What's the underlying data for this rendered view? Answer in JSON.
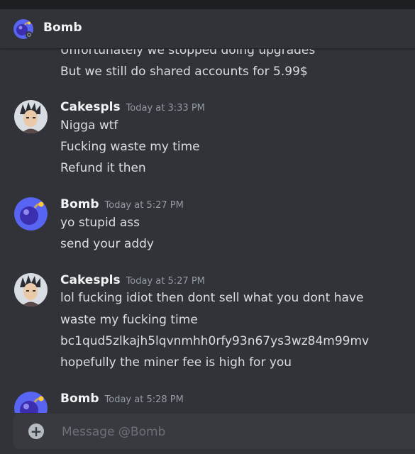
{
  "header": {
    "title": "Bomb"
  },
  "messages": [
    {
      "type": "continuation",
      "lines": [
        "Unfortunately we stopped doing upgrades",
        "But we still do shared accounts for 5.99$"
      ]
    },
    {
      "author": "Cakespls",
      "time": "Today at 3:33 PM",
      "avatar": "anime-avatar",
      "lines": [
        "Nigga wtf",
        "Fucking waste my time",
        "Refund it then"
      ]
    },
    {
      "author": "Bomb",
      "time": "Today at 5:27 PM",
      "avatar": "bomb-avatar",
      "lines": [
        "yo stupid ass",
        "send your addy"
      ]
    },
    {
      "author": "Cakespls",
      "time": "Today at 5:27 PM",
      "avatar": "anime-avatar",
      "lines": [
        "lol fucking idiot then dont sell what you dont have",
        "waste my fucking time",
        "bc1qud5zlkajh5lqvnmhh0rfy93n67ys3wz84m99mv",
        "hopefully the miner fee is high for you"
      ]
    },
    {
      "author": "Bomb",
      "time": "Today at 5:28 PM",
      "avatar": "bomb-avatar",
      "lines": []
    }
  ],
  "composer": {
    "placeholder": "Message @Bomb",
    "plus_icon": "plus-circle-icon"
  },
  "colors": {
    "background": "#313338",
    "composer": "#383a40",
    "timestamp": "#949ba4",
    "bomb": "#4b3fd6"
  }
}
